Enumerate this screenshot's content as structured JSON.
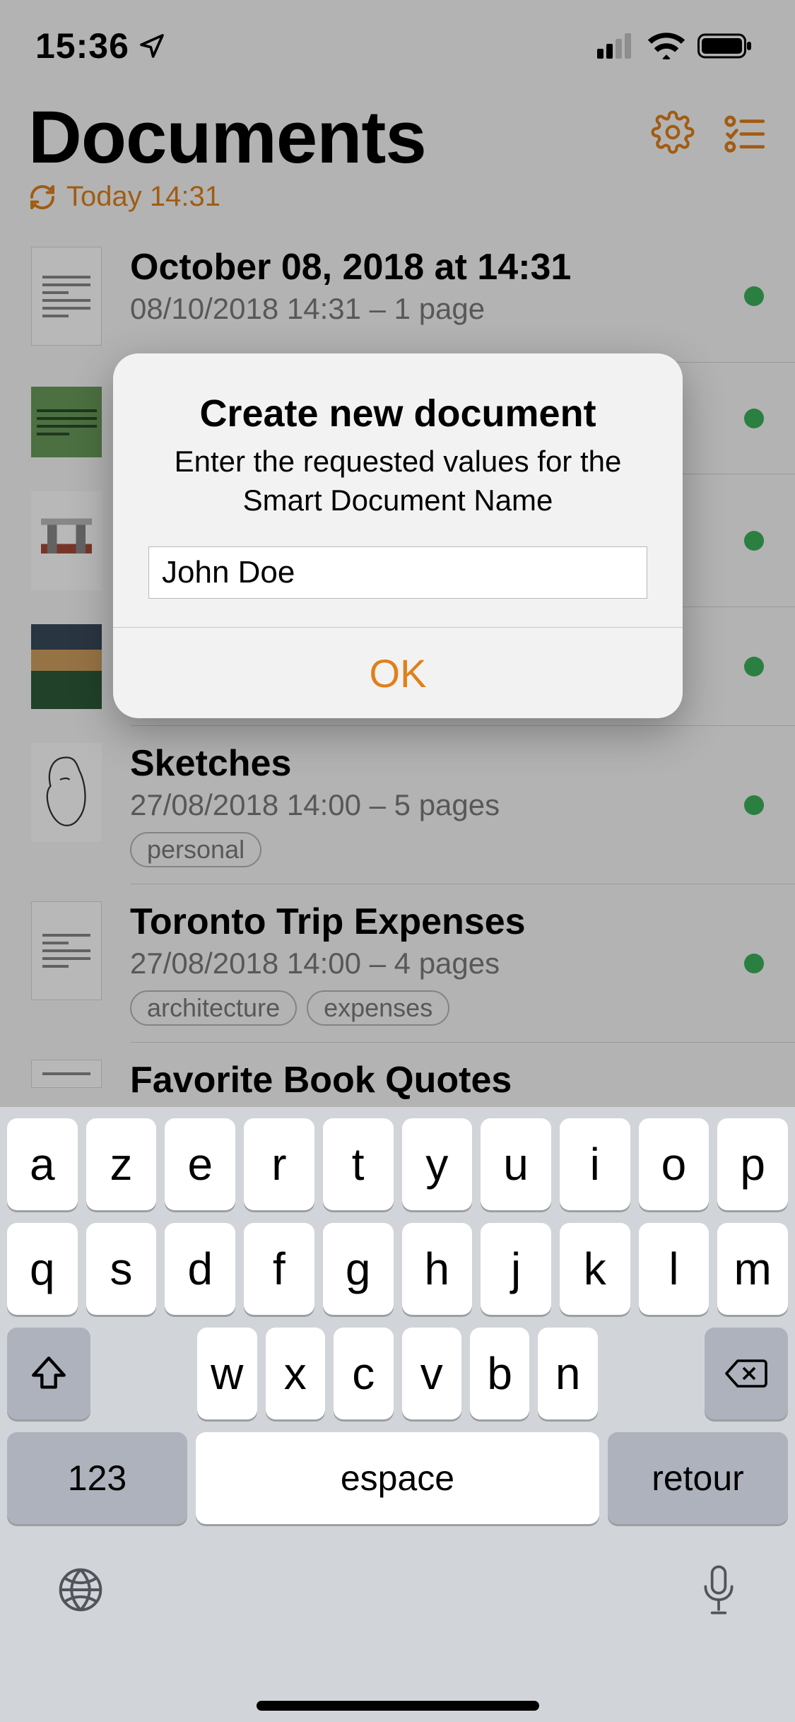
{
  "statusbar": {
    "time": "15:36"
  },
  "header": {
    "title": "Documents",
    "sync_label": "Today 14:31"
  },
  "colors": {
    "accent": "#e0801a",
    "status_dot": "#3cb05a"
  },
  "documents": [
    {
      "title": "October 08, 2018 at 14:31",
      "subtitle": "08/10/2018 14:31 – 1 page",
      "tags": []
    },
    {
      "title": "",
      "subtitle": "",
      "tags": []
    },
    {
      "title": "",
      "subtitle": "",
      "tags": []
    },
    {
      "title": "",
      "subtitle": "",
      "tags": []
    },
    {
      "title": "Sketches",
      "subtitle": "27/08/2018 14:00 – 5 pages",
      "tags": [
        "personal"
      ]
    },
    {
      "title": "Toronto Trip Expenses",
      "subtitle": "27/08/2018 14:00 – 4 pages",
      "tags": [
        "architecture",
        "expenses"
      ]
    },
    {
      "title": "Favorite Book Quotes",
      "subtitle": "",
      "tags": []
    }
  ],
  "modal": {
    "title": "Create new document",
    "message": "Enter the requested values for the Smart Document Name",
    "input_value": "John Doe",
    "ok_label": "OK"
  },
  "keyboard": {
    "row1": [
      "a",
      "z",
      "e",
      "r",
      "t",
      "y",
      "u",
      "i",
      "o",
      "p"
    ],
    "row2": [
      "q",
      "s",
      "d",
      "f",
      "g",
      "h",
      "j",
      "k",
      "l",
      "m"
    ],
    "row3": [
      "w",
      "x",
      "c",
      "v",
      "b",
      "n"
    ],
    "num_label": "123",
    "space_label": "espace",
    "return_label": "retour"
  }
}
